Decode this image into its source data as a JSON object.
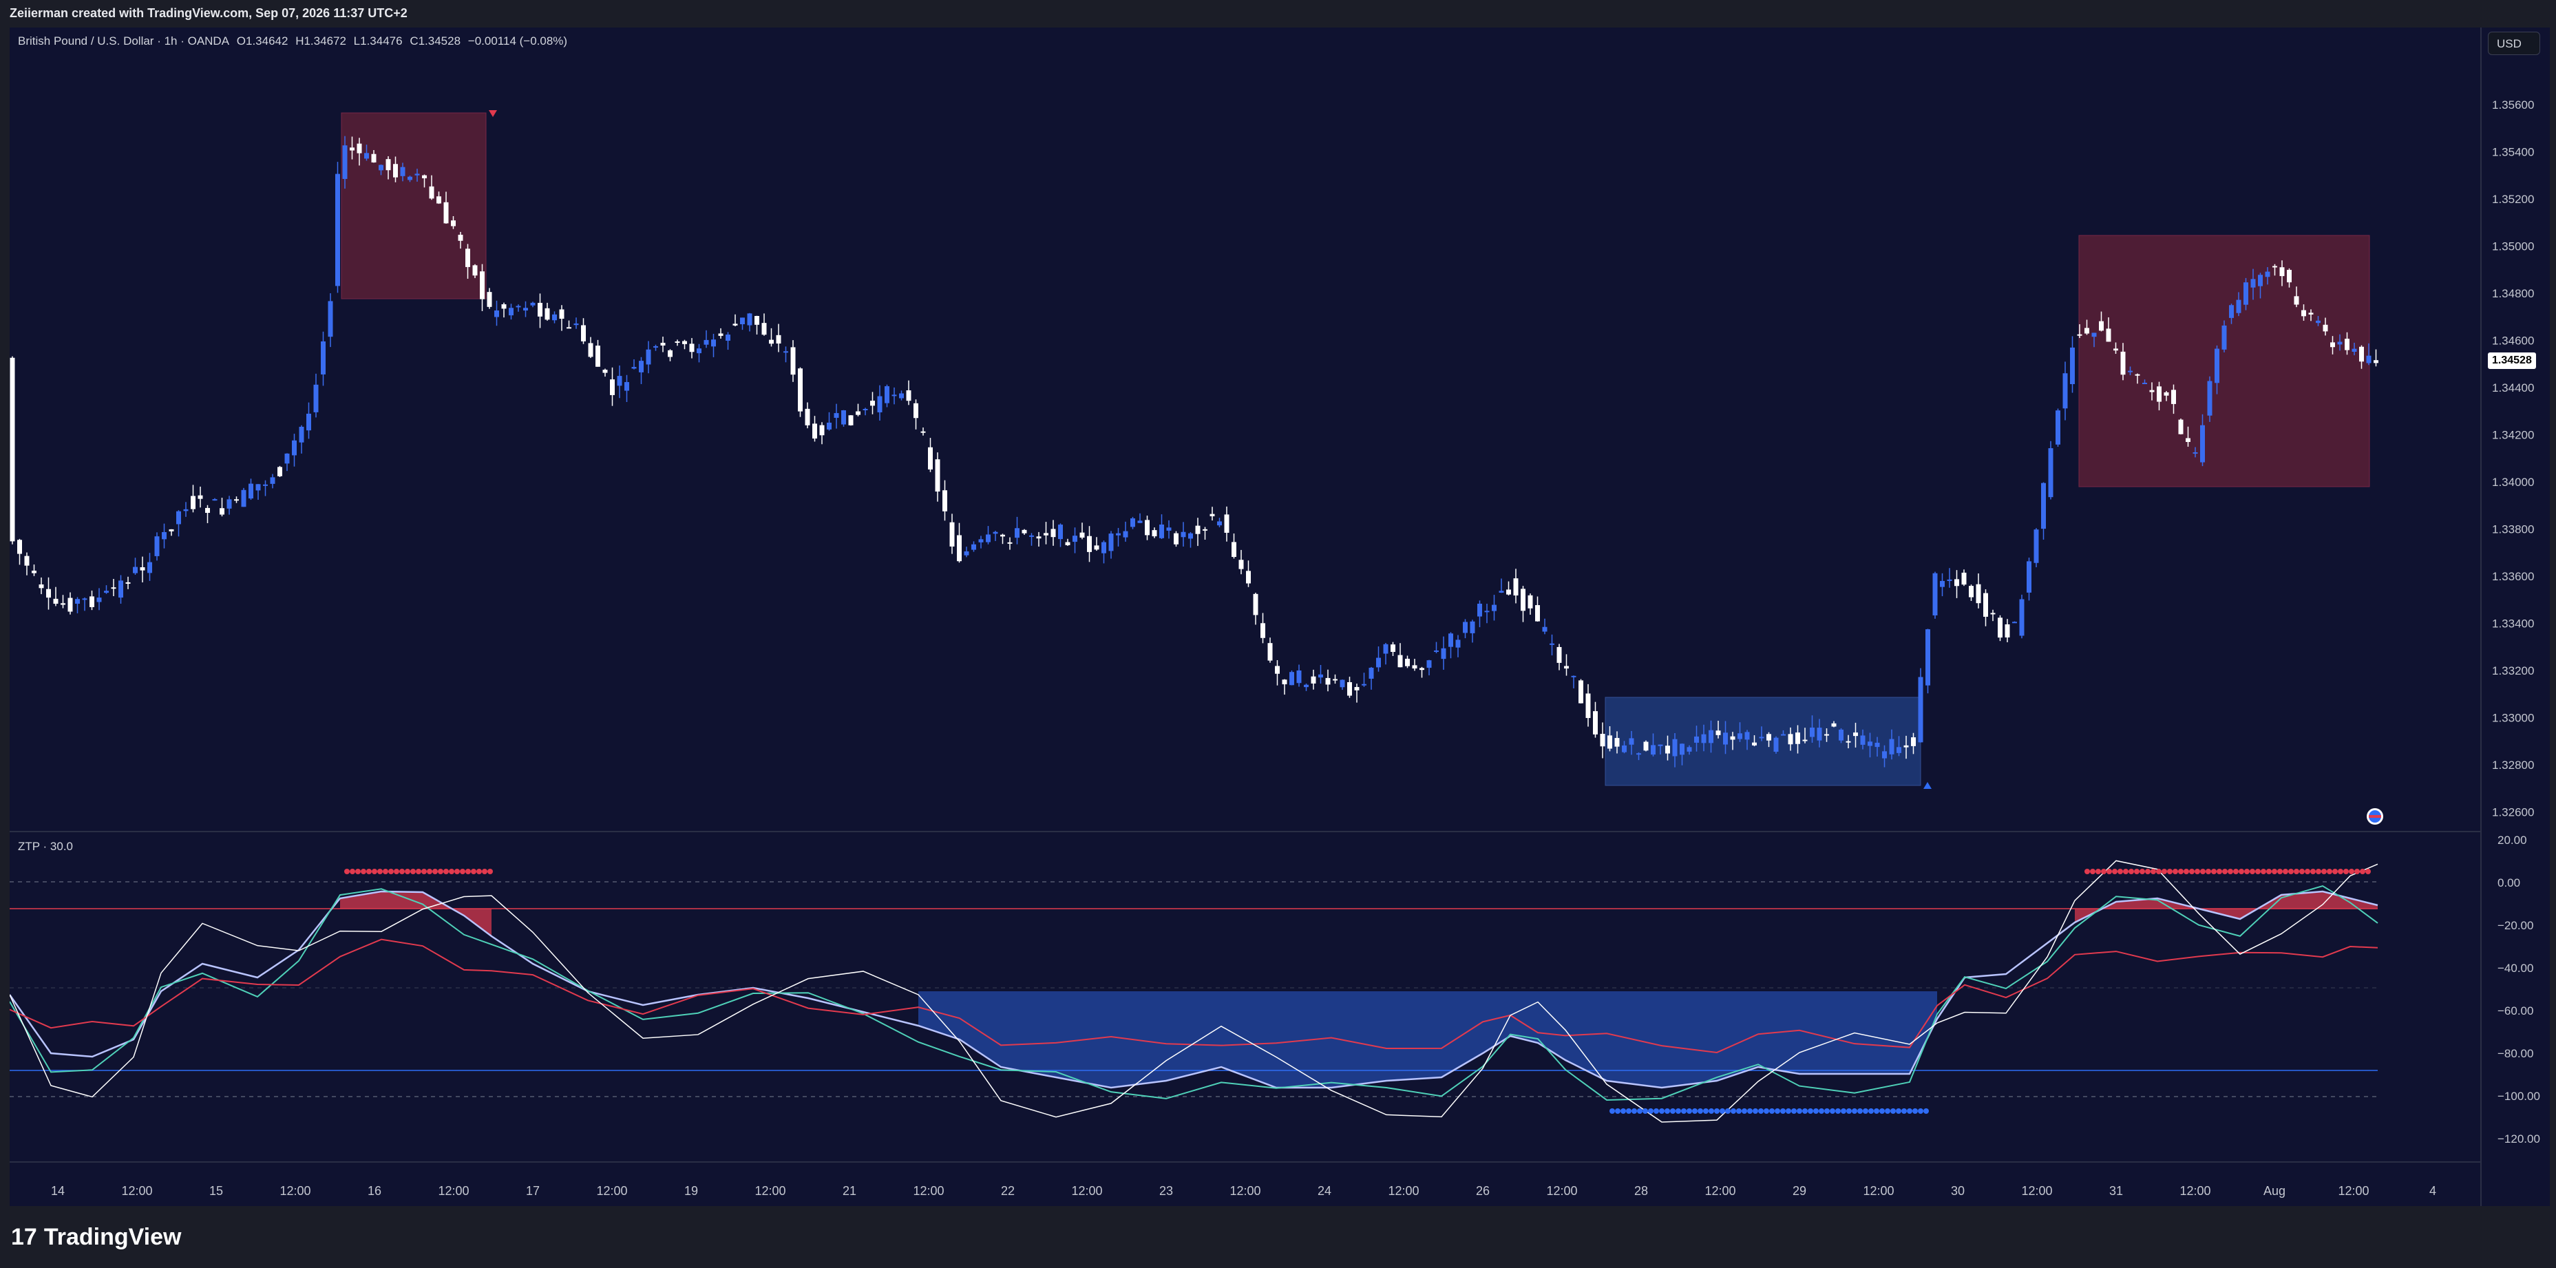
{
  "header": {
    "caption": "Zeiierman created with TradingView.com, Sep 07, 2026 11:37 UTC+2"
  },
  "legend": {
    "symbol": "British Pound / U.S. Dollar · 1h · OANDA",
    "open": "O1.34642",
    "high": "H1.34672",
    "low": "L1.34476",
    "close": "C1.34528",
    "change": "−0.00114 (−0.08%)"
  },
  "currency_button": "USD",
  "price_axis": {
    "labels": [
      "1.35600",
      "1.35400",
      "1.35200",
      "1.35000",
      "1.34800",
      "1.34600",
      "1.34400",
      "1.34200",
      "1.34000",
      "1.33800",
      "1.33600",
      "1.33400",
      "1.33200",
      "1.33000",
      "1.32800",
      "1.32600"
    ],
    "last_price": "1.34528"
  },
  "indicator": {
    "label": "ZTP · 30.0",
    "axis_labels": [
      "20.00",
      "0.00",
      "−20.00",
      "−40.00",
      "−60.00",
      "−80.00",
      "−100.00",
      "−120.00"
    ]
  },
  "time_axis": {
    "labels": [
      "14",
      "12:00",
      "15",
      "12:00",
      "16",
      "12:00",
      "17",
      "12:00",
      "19",
      "12:00",
      "21",
      "12:00",
      "22",
      "12:00",
      "23",
      "12:00",
      "24",
      "12:00",
      "26",
      "12:00",
      "28",
      "12:00",
      "29",
      "12:00",
      "30",
      "12:00",
      "31",
      "12:00",
      "Aug",
      "12:00",
      "4"
    ]
  },
  "footer": {
    "brand": "TradingView",
    "mark": "17"
  },
  "colors": {
    "background": "#0f1230",
    "bull_candle": "#3a6df0",
    "bear_candle": "#ffffff",
    "red_zone": "#5a1f36",
    "blue_zone": "#1f3a7a",
    "ztp_red": "#e23a4e",
    "ztp_blue": "#2f6cf5",
    "teal": "#4fd1b8"
  }
}
